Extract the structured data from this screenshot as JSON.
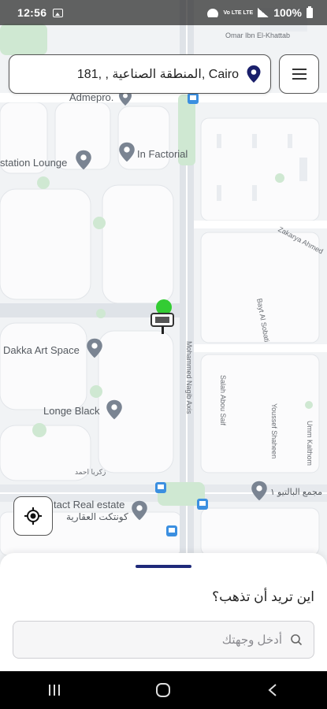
{
  "status_bar": {
    "time": "12:56",
    "network_label": "Vo LTE LTE",
    "battery_percent": "100%"
  },
  "location_bar": {
    "address": "181, , المنطقة الصناعية, Cairo",
    "pin_color": "#1a1f6b"
  },
  "map": {
    "place_labels": [
      "Omar Ibn El-Khattab",
      "Admepro.",
      "station Lounge",
      "In Factorial",
      "Dakka Art Space",
      "Longe Black",
      "tact Real estate",
      "كونتكت العقارية",
      "مجمع البالتيو ١",
      "زكريا احمد"
    ],
    "street_labels": [
      "Zakarya Ahmed",
      "Bayt Al Sobati",
      "Mohammed Nagib Axis",
      "Salah Abou Saif",
      "Youssef Shaheen",
      "Umm Kalthom"
    ],
    "driver_status_color": "#33cc33"
  },
  "bottom_sheet": {
    "question": "اين تريد أن تذهب؟",
    "destination_placeholder": "أدخل وجهتك"
  },
  "accent_color": "#1f2a7a"
}
